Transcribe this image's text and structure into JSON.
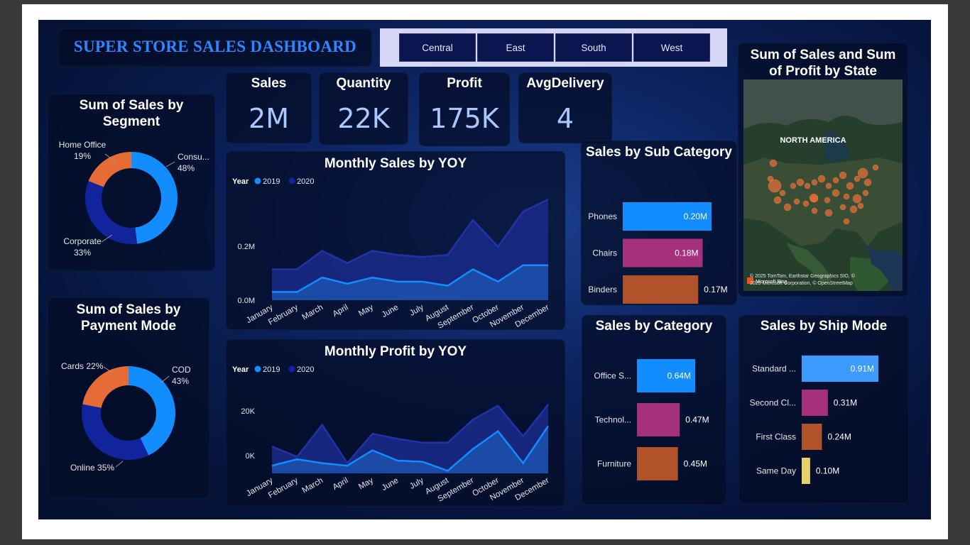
{
  "header": {
    "title": "SUPER STORE SALES DASHBOARD"
  },
  "region_slicer": [
    "Central",
    "East",
    "South",
    "West"
  ],
  "kpis": [
    {
      "label": "Sales",
      "value": "2M"
    },
    {
      "label": "Quantity",
      "value": "22K"
    },
    {
      "label": "Profit",
      "value": "175K"
    },
    {
      "label": "AvgDelivery",
      "value": "4"
    }
  ],
  "map": {
    "title": "Sum of Sales and Sum of Profit by State",
    "region_label": "NORTH AMERICA",
    "attribution": "© 2025 TomTom, Earthstar Geographics SIO, © 2025 Microsoft Corporation, © OpenStreetMap",
    "logo": "Microsoft Bing"
  },
  "colors": {
    "blue_light": "#118dff",
    "blue_dark": "#12239e",
    "pink": "#a5307c",
    "orange": "#e66c37",
    "rust": "#b0532b",
    "yellow": "#e8d166",
    "ship_blue": "#3d9bff"
  },
  "chart_data": [
    {
      "id": "segment",
      "type": "pie",
      "title": "Sum of Sales by Segment",
      "categories": [
        "Consumer",
        "Corporate",
        "Home Office"
      ],
      "values": [
        48,
        33,
        19
      ],
      "labels": [
        "Consu... 48%",
        "Corporate 33%",
        "Home Office 19%"
      ],
      "unit": "%"
    },
    {
      "id": "payment",
      "type": "pie",
      "title": "Sum of Sales by Payment Mode",
      "categories": [
        "COD",
        "Online",
        "Cards"
      ],
      "values": [
        43,
        35,
        22
      ],
      "labels": [
        "COD 43%",
        "Online 35%",
        "Cards 22%"
      ],
      "unit": "%"
    },
    {
      "id": "monthly_sales",
      "type": "area",
      "title": "Monthly Sales by YOY",
      "legend_title": "Year",
      "legend": "top-left",
      "categories": [
        "January",
        "February",
        "March",
        "April",
        "May",
        "June",
        "July",
        "August",
        "September",
        "October",
        "November",
        "December"
      ],
      "series": [
        {
          "name": "2019",
          "values": [
            0.02,
            0.02,
            0.055,
            0.04,
            0.055,
            0.045,
            0.045,
            0.035,
            0.075,
            0.045,
            0.085,
            0.085
          ]
        },
        {
          "name": "2020",
          "values": [
            0.075,
            0.075,
            0.12,
            0.09,
            0.12,
            0.11,
            0.105,
            0.11,
            0.195,
            0.13,
            0.215,
            0.245
          ]
        }
      ],
      "y_ticks": [
        "0.0M",
        "0.2M"
      ],
      "ylim": [
        0,
        0.25
      ],
      "unit": "M"
    },
    {
      "id": "monthly_profit",
      "type": "area",
      "title": "Monthly Profit by YOY",
      "legend_title": "Year",
      "legend": "top-left",
      "categories": [
        "January",
        "February",
        "March",
        "April",
        "May",
        "June",
        "July",
        "August",
        "September",
        "October",
        "November",
        "December"
      ],
      "series": [
        {
          "name": "2019",
          "values": [
            3000,
            5500,
            4000,
            3000,
            9000,
            5000,
            4500,
            1000,
            9500,
            16500,
            4000,
            18500
          ]
        },
        {
          "name": "2020",
          "values": [
            10500,
            6500,
            19000,
            4000,
            15500,
            13500,
            12000,
            12000,
            21000,
            26500,
            14500,
            27000
          ]
        }
      ],
      "y_ticks": [
        "0K",
        "20K"
      ],
      "ylim": [
        0,
        30000
      ],
      "unit": "K"
    },
    {
      "id": "subcategory",
      "type": "bar",
      "title": "Sales by Sub Category",
      "categories": [
        "Phones",
        "Chairs",
        "Binders"
      ],
      "values": [
        0.2,
        0.18,
        0.17
      ],
      "data_labels": [
        "0.20M",
        "0.18M",
        "0.17M"
      ],
      "unit": "M"
    },
    {
      "id": "category",
      "type": "bar",
      "title": "Sales by Category",
      "categories": [
        "Office S...",
        "Technol...",
        "Furniture"
      ],
      "values": [
        0.64,
        0.47,
        0.45
      ],
      "data_labels": [
        "0.64M",
        "0.47M",
        "0.45M"
      ],
      "unit": "M"
    },
    {
      "id": "shipmode",
      "type": "bar",
      "title": "Sales by Ship Mode",
      "categories": [
        "Standard ...",
        "Second Cl...",
        "First Class",
        "Same Day"
      ],
      "values": [
        0.91,
        0.31,
        0.24,
        0.1
      ],
      "data_labels": [
        "0.91M",
        "0.31M",
        "0.24M",
        "0.10M"
      ],
      "unit": "M"
    }
  ]
}
